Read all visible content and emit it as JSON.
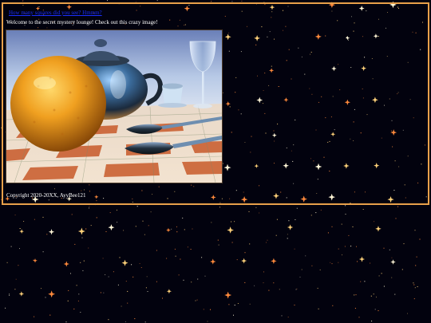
{
  "page": {
    "top_link": "How many squares did you see? Hmmm?",
    "welcome_text": "Welcome to the secret mystery lounge! Check out this crazy image!",
    "copyright": "Copyright 2020-20XX, AyyBee121"
  },
  "colors": {
    "background": "#02020e",
    "panel_border": "#e8a04a",
    "link": "#1a2fff",
    "text": "#ffffff",
    "star_gold": "#ffd27a",
    "star_orange": "#ff8a3c",
    "star_white": "#fff6d8"
  },
  "artwork": {
    "description_icon": "still-life-image",
    "subjects": [
      "orange",
      "teapot",
      "wine-glass",
      "cup",
      "spoons",
      "checkered-table"
    ]
  }
}
